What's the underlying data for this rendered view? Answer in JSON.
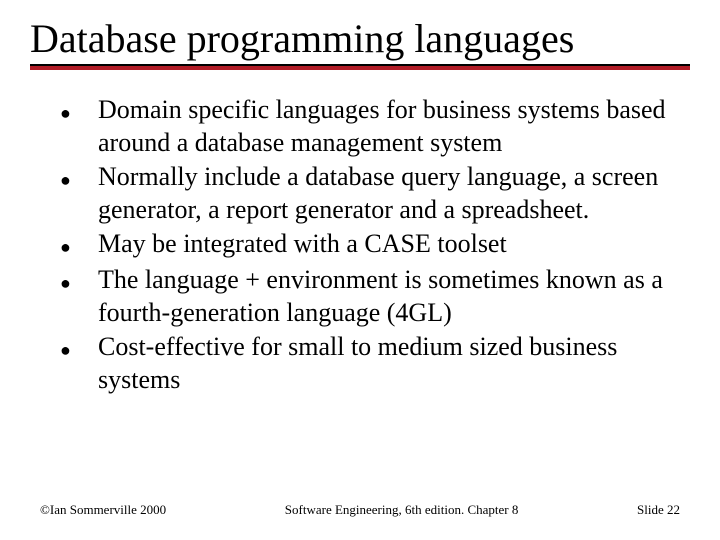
{
  "slide": {
    "title": "Database programming languages",
    "bullets": [
      "Domain specific languages for business systems based around a database management system",
      "Normally include a database query language, a screen generator, a report generator and a spreadsheet.",
      "May be integrated with a CASE toolset",
      "The language + environment is sometimes known as a fourth-generation language (4GL)",
      "Cost-effective for small to medium sized business systems"
    ],
    "bullet_glyph": "●"
  },
  "footer": {
    "left": "©Ian Sommerville 2000",
    "center": "Software Engineering, 6th edition. Chapter 8",
    "right": "Slide 22"
  },
  "colors": {
    "accent": "#b21d27"
  }
}
